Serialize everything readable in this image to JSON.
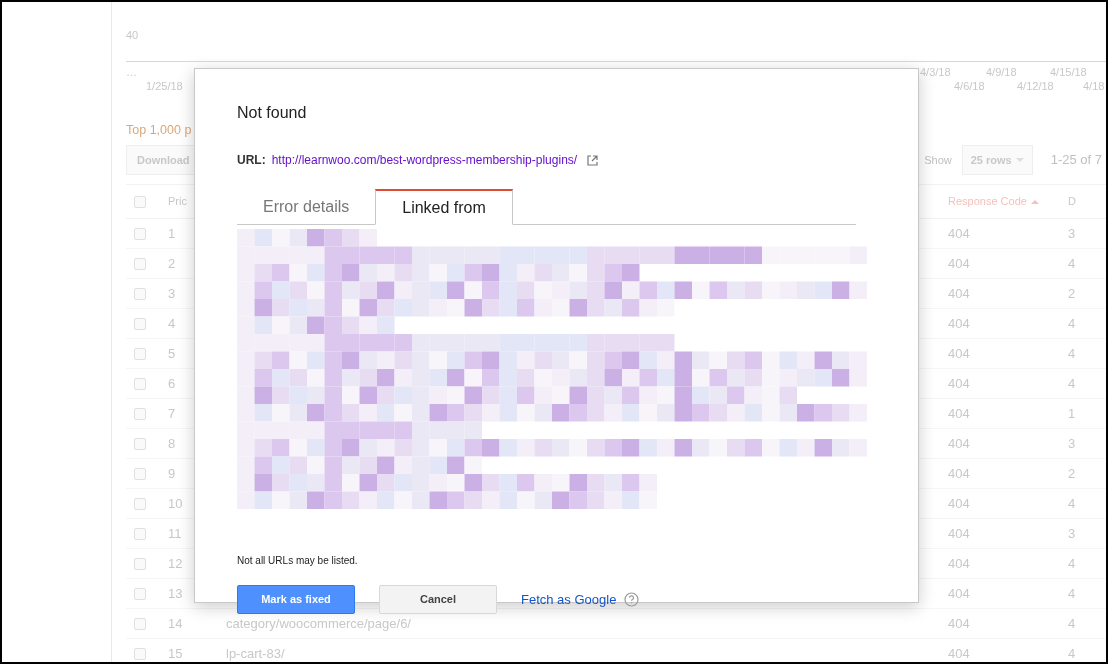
{
  "chart": {
    "y_label": "40",
    "x_labels_top": [
      "…",
      "4/3/18",
      "4/9/18",
      "4/15/18"
    ],
    "x_labels_bottom": [
      "1/25/18",
      "4/6/18",
      "4/12/18",
      "4/18"
    ]
  },
  "section_title": "Top 1,000 p",
  "toolbar": {
    "download": "Download",
    "show_label": "Show",
    "rows_select": "25 rows",
    "pagination": "1-25 of 7"
  },
  "table": {
    "all_checked": false,
    "columns": [
      "Pric",
      "Response Code",
      "D"
    ],
    "rows": [
      {
        "num": "1",
        "url": "",
        "code": "404",
        "column_5": "3",
        "checked": false
      },
      {
        "num": "2",
        "url": "",
        "code": "404",
        "column_5": "4",
        "checked": false
      },
      {
        "num": "3",
        "url": "",
        "code": "404",
        "column_5": "2",
        "checked": false
      },
      {
        "num": "4",
        "url": "",
        "code": "404",
        "column_5": "4",
        "checked": false
      },
      {
        "num": "5",
        "url": "",
        "code": "404",
        "column_5": "4",
        "checked": false
      },
      {
        "num": "6",
        "url": "",
        "code": "404",
        "column_5": "4",
        "checked": false
      },
      {
        "num": "7",
        "url": "",
        "code": "404",
        "column_5": "1",
        "checked": false
      },
      {
        "num": "8",
        "url": "",
        "code": "404",
        "column_5": "3",
        "checked": false
      },
      {
        "num": "9",
        "url": "",
        "code": "404",
        "column_5": "2",
        "checked": false
      },
      {
        "num": "10",
        "url": "",
        "code": "404",
        "column_5": "4",
        "checked": false
      },
      {
        "num": "11",
        "url": "",
        "code": "404",
        "column_5": "3",
        "checked": false
      },
      {
        "num": "12",
        "url": "",
        "code": "404",
        "column_5": "4",
        "checked": false
      },
      {
        "num": "13",
        "url": "",
        "code": "404",
        "column_5": "4",
        "checked": false
      },
      {
        "num": "14",
        "url": "category/woocommerce/page/6/",
        "code": "404",
        "column_5": "4",
        "checked": false
      },
      {
        "num": "15",
        "url": "lp-cart-83/",
        "code": "404",
        "column_5": "4",
        "checked": false
      }
    ]
  },
  "dialog": {
    "title": "Not found",
    "url_label": "URL:",
    "url": "http://learnwoo.com/best-wordpress-membership-plugins/",
    "tabs": [
      {
        "label": "Error details",
        "selected": false
      },
      {
        "label": "Linked from",
        "selected": true
      }
    ],
    "note": "Not all URLs may be listed.",
    "buttons": [
      {
        "label": "Mark as fixed",
        "kind": "primary"
      },
      {
        "label": "Cancel",
        "kind": "secondary"
      }
    ],
    "link": "Fetch as Google"
  }
}
